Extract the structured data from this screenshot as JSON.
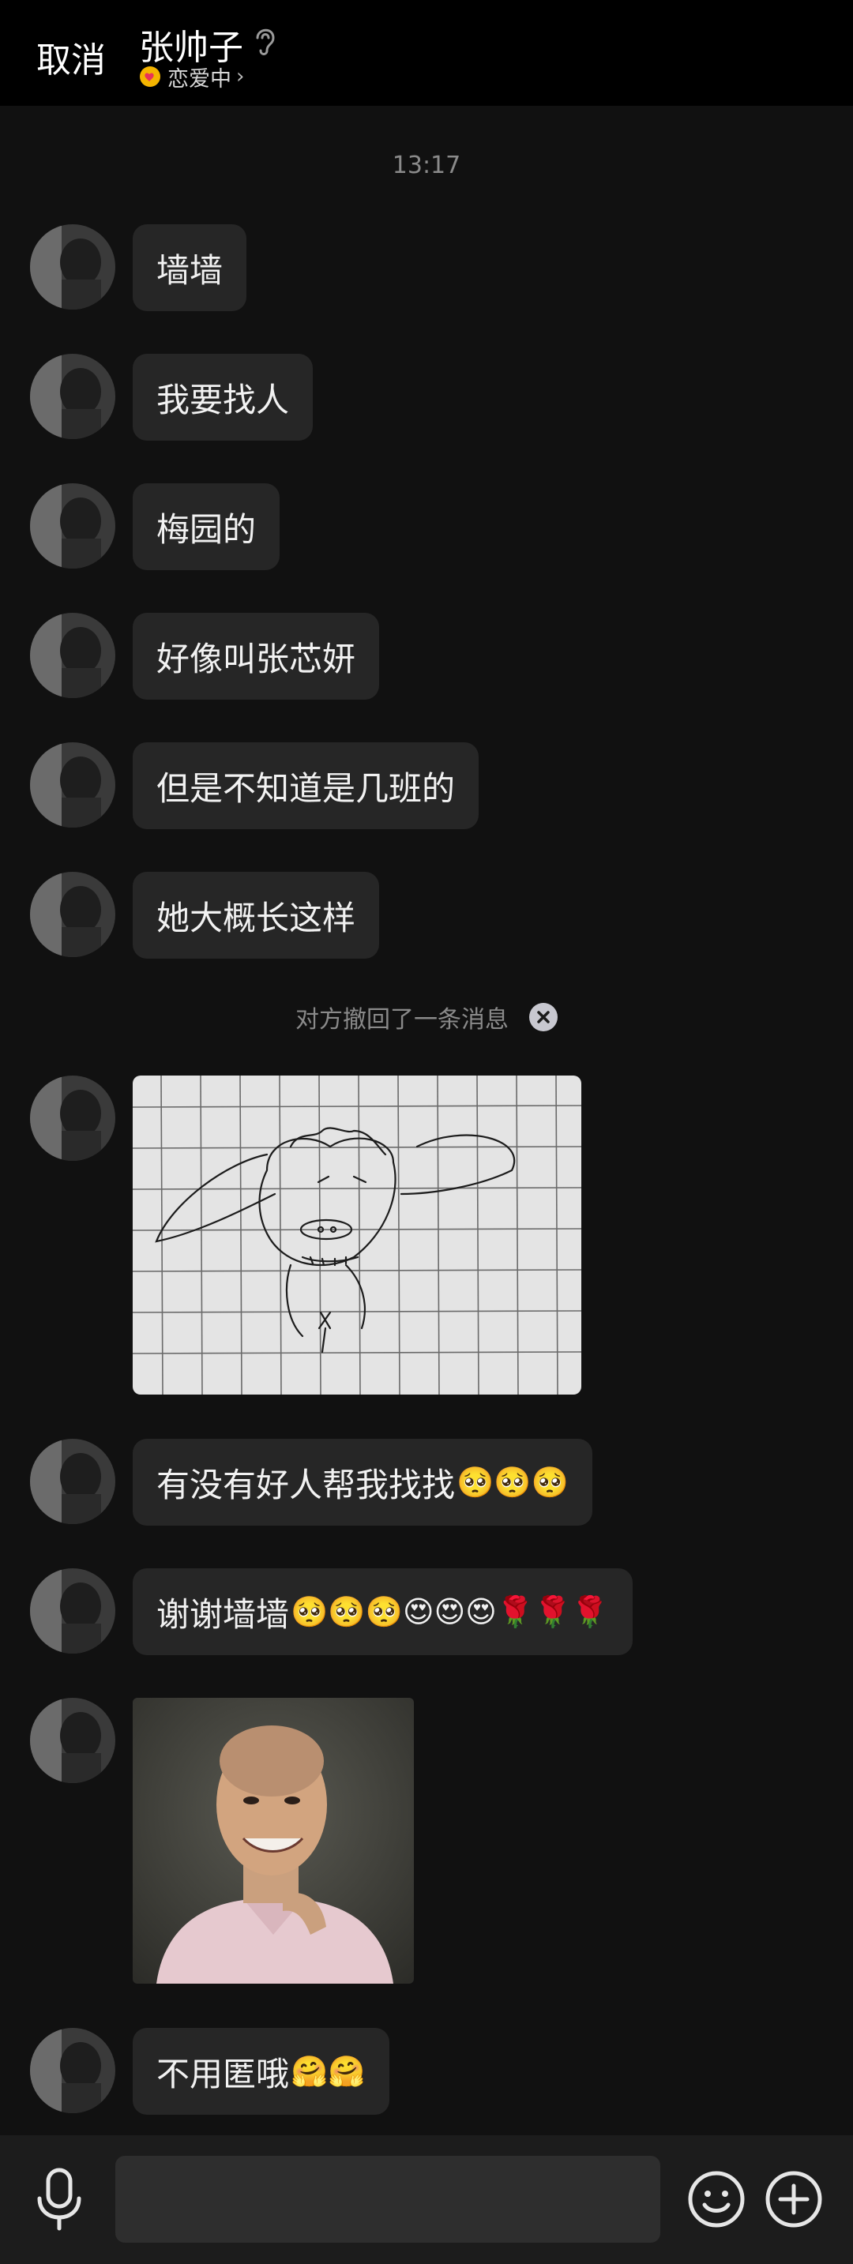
{
  "header": {
    "cancel_label": "取消",
    "contact_name": "张帅子",
    "status_text": "恋爱中",
    "status_chevron": "›"
  },
  "chat": {
    "timestamp": "13:17",
    "messages": [
      {
        "type": "text",
        "text": "墙墙"
      },
      {
        "type": "text",
        "text": "我要找人"
      },
      {
        "type": "text",
        "text": "梅园的"
      },
      {
        "type": "text",
        "text": "好像叫张芯妍"
      },
      {
        "type": "text",
        "text": "但是不知道是几班的"
      },
      {
        "type": "text",
        "text": "她大概长这样"
      },
      {
        "type": "recall",
        "text": "对方撤回了一条消息"
      },
      {
        "type": "image",
        "description_icon": "pig-drawing-image"
      },
      {
        "type": "text",
        "text": "有没有好人帮我找找",
        "emoji": "🥺🥺🥺"
      },
      {
        "type": "text",
        "text": "谢谢墙墙",
        "emoji": "🥺🥺🥺😍😍😍🌹🌹🌹"
      },
      {
        "type": "image",
        "description_icon": "smiling-man-photo"
      },
      {
        "type": "text",
        "text": "不用匿哦",
        "emoji": "🤗🤗"
      }
    ]
  },
  "input_bar": {
    "placeholder": "",
    "icons": [
      "microphone-icon",
      "emoji-icon",
      "add-icon"
    ]
  },
  "colors": {
    "background": "#111111",
    "header": "#000000",
    "bubble": "#262626",
    "input_bar": "#1c1c1c"
  }
}
